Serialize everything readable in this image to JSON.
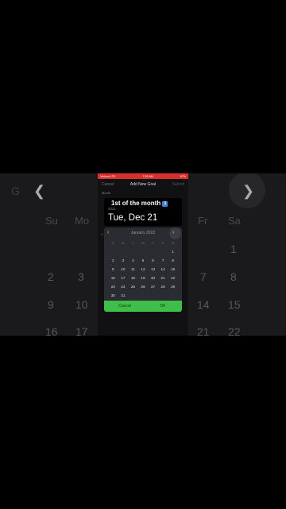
{
  "background_calendar": {
    "g_label": "G",
    "weekdays": [
      "Su",
      "Mo",
      "Fr",
      "Sa"
    ],
    "days": [
      "1",
      "2",
      "3",
      "7",
      "8",
      "9",
      "10",
      "14",
      "15",
      "16",
      "17",
      "21",
      "22"
    ]
  },
  "status_bar": {
    "carrier": "Verizon LTE",
    "time": "7:32 AM",
    "battery": "57%"
  },
  "nav": {
    "cancel": "Cancel",
    "title": "Add New Goal",
    "submit": "Submit"
  },
  "form": {
    "month_label": "Month",
    "u_label": "U"
  },
  "goal": {
    "title": "1st of the month",
    "emoji": "1"
  },
  "date_picker": {
    "year": "2021",
    "selected_date": "Tue, Dec 21",
    "month": "January 2022",
    "weekdays": [
      "S",
      "M",
      "T",
      "W",
      "T",
      "F",
      "S"
    ],
    "weeks": [
      [
        "",
        "",
        "",
        "",
        "",
        "",
        "1"
      ],
      [
        "2",
        "3",
        "4",
        "5",
        "6",
        "7",
        "8"
      ],
      [
        "9",
        "10",
        "11",
        "12",
        "13",
        "14",
        "15"
      ],
      [
        "16",
        "17",
        "18",
        "19",
        "20",
        "21",
        "22"
      ],
      [
        "23",
        "24",
        "25",
        "26",
        "27",
        "28",
        "29"
      ],
      [
        "30",
        "31",
        "",
        "",
        "",
        "",
        ""
      ]
    ],
    "cancel": "Cancel",
    "ok": "OK"
  },
  "colors": {
    "status_bar": "#d72f2b",
    "button_bar": "#3fbe4a"
  }
}
